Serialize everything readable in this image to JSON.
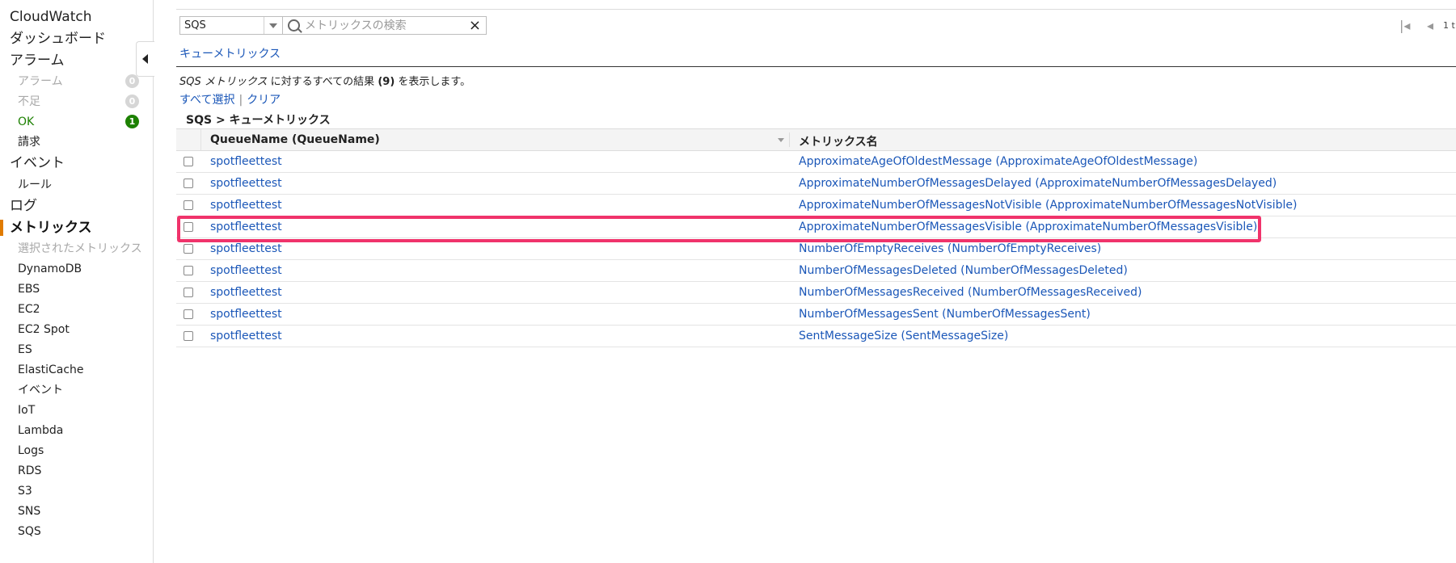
{
  "sidebar": {
    "items": [
      {
        "label": "CloudWatch"
      },
      {
        "label": "ダッシュボード"
      },
      {
        "label": "アラーム"
      },
      {
        "label": "アラーム",
        "count": "0"
      },
      {
        "label": "不足",
        "count": "0"
      },
      {
        "label": "OK",
        "count": "1"
      },
      {
        "label": "請求"
      },
      {
        "label": "イベント"
      },
      {
        "label": "ルール"
      },
      {
        "label": "ログ"
      },
      {
        "label": "メトリックス"
      },
      {
        "label": "選択されたメトリックス"
      },
      {
        "label": "DynamoDB"
      },
      {
        "label": "EBS"
      },
      {
        "label": "EC2"
      },
      {
        "label": "EC2 Spot"
      },
      {
        "label": "ES"
      },
      {
        "label": "ElastiCache"
      },
      {
        "label": "イベント"
      },
      {
        "label": "IoT"
      },
      {
        "label": "Lambda"
      },
      {
        "label": "Logs"
      },
      {
        "label": "RDS"
      },
      {
        "label": "S3"
      },
      {
        "label": "SNS"
      },
      {
        "label": "SQS"
      }
    ]
  },
  "toolbar": {
    "namespace": "SQS",
    "search_placeholder": "メトリックスの検索",
    "clear_icon": "×",
    "pager_first": "|◂",
    "pager_prev": "◂",
    "pager_text": "1 t"
  },
  "main": {
    "crumb_link": "キューメトリックス",
    "summary_prefix": "SQS メトリックス",
    "summary_middle": " に対するすべての結果 ",
    "summary_count": "(9)",
    "summary_suffix": " を表示します。",
    "select_all": "すべて選択",
    "separator": "|",
    "clear": "クリア",
    "group_title": "SQS > キューメトリックス",
    "col_queue": "QueueName (QueueName)",
    "col_metric": "メトリックス名",
    "rows": [
      {
        "queue": "spotfleettest",
        "metric": "ApproximateAgeOfOldestMessage (ApproximateAgeOfOldestMessage)"
      },
      {
        "queue": "spotfleettest",
        "metric": "ApproximateNumberOfMessagesDelayed (ApproximateNumberOfMessagesDelayed)"
      },
      {
        "queue": "spotfleettest",
        "metric": "ApproximateNumberOfMessagesNotVisible (ApproximateNumberOfMessagesNotVisible)"
      },
      {
        "queue": "spotfleettest",
        "metric": "ApproximateNumberOfMessagesVisible (ApproximateNumberOfMessagesVisible)"
      },
      {
        "queue": "spotfleettest",
        "metric": "NumberOfEmptyReceives (NumberOfEmptyReceives)"
      },
      {
        "queue": "spotfleettest",
        "metric": "NumberOfMessagesDeleted (NumberOfMessagesDeleted)"
      },
      {
        "queue": "spotfleettest",
        "metric": "NumberOfMessagesReceived (NumberOfMessagesReceived)"
      },
      {
        "queue": "spotfleettest",
        "metric": "NumberOfMessagesSent (NumberOfMessagesSent)"
      },
      {
        "queue": "spotfleettest",
        "metric": "SentMessageSize (SentMessageSize)"
      }
    ]
  },
  "colors": {
    "link": "#1b57b8",
    "ok_green": "#1d8102",
    "active_orange": "#e07b00",
    "highlight_pink": "#f0336b"
  }
}
